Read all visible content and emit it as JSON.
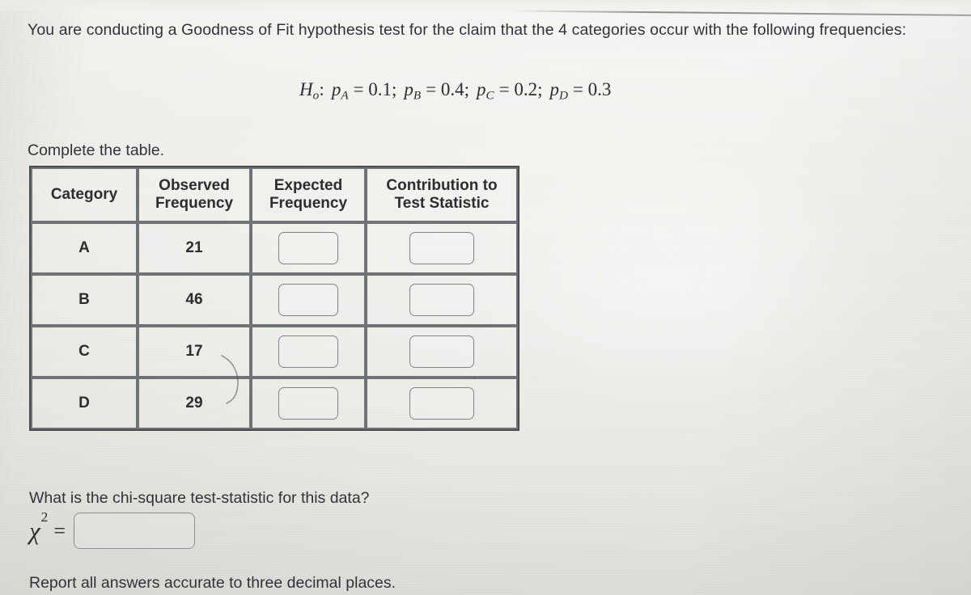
{
  "prompt": {
    "line1": "You are conducting a Goodness of Fit hypothesis test for the claim that the 4 categories occur with the",
    "line2": "following frequencies:"
  },
  "hypothesis": {
    "symbol": "H",
    "subscript": "o",
    "colon": ":",
    "terms": [
      {
        "p": "p",
        "sub": "A",
        "eq": "=",
        "value": "0.1",
        "sep": ";"
      },
      {
        "p": "p",
        "sub": "B",
        "eq": "=",
        "value": "0.4",
        "sep": ";"
      },
      {
        "p": "p",
        "sub": "C",
        "eq": "=",
        "value": "0.2",
        "sep": ";"
      },
      {
        "p": "p",
        "sub": "D",
        "eq": "=",
        "value": "0.3",
        "sep": ""
      }
    ],
    "plain_text": "Ho : pA = 0.1;  pB = 0.4;  pC = 0.2;  pD = 0.3"
  },
  "instructions": {
    "complete_table": "Complete the table.",
    "question": "What is the chi-square test-statistic for this data?",
    "report_note": "Report all answers accurate to three decimal places."
  },
  "table": {
    "headers": [
      "Category",
      "Observed Frequency",
      "Expected Frequency",
      "Contribution to Test Statistic"
    ],
    "header_lines": [
      [
        "Category"
      ],
      [
        "Observed",
        "Frequency"
      ],
      [
        "Expected",
        "Frequency"
      ],
      [
        "Contribution to",
        "Test Statistic"
      ]
    ],
    "rows": [
      {
        "category": "A",
        "observed": "21",
        "expected": "",
        "contribution": ""
      },
      {
        "category": "B",
        "observed": "46",
        "expected": "",
        "contribution": ""
      },
      {
        "category": "C",
        "observed": "17",
        "expected": "",
        "contribution": ""
      },
      {
        "category": "D",
        "observed": "29",
        "expected": "",
        "contribution": ""
      }
    ]
  },
  "chi_square": {
    "symbol": "χ",
    "exponent": "2",
    "equals": "=",
    "value": "",
    "placeholder": ""
  },
  "colors": {
    "page_background": "#f2f1ed",
    "text": "#30333a",
    "table_border": "#6f7276",
    "table_outer_border": "#4a4d50",
    "input_border": "#80848a"
  }
}
